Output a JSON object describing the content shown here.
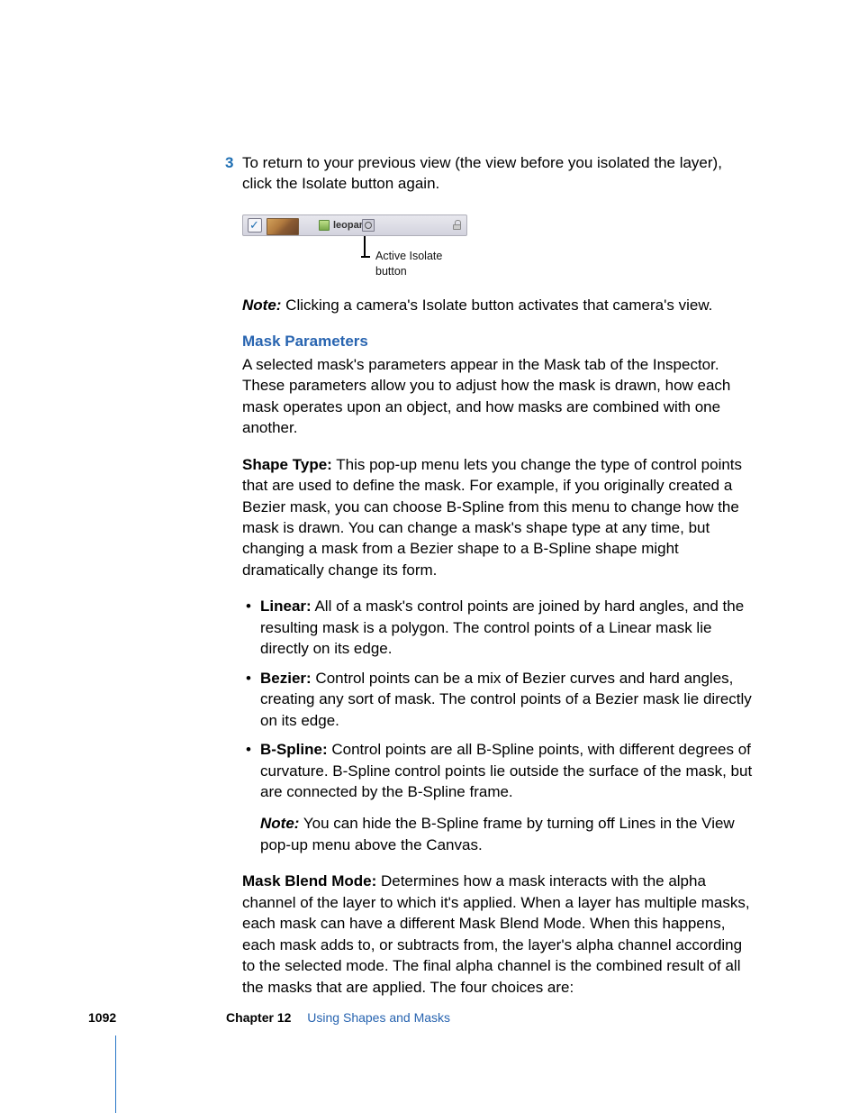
{
  "step": {
    "num": "3",
    "text": "To return to your previous view (the view before you isolated the layer), click the Isolate button again."
  },
  "figure": {
    "layer_name": "leopard",
    "caption": "Active Isolate button"
  },
  "note1": {
    "label": "Note:",
    "text": " Clicking a camera's Isolate button activates that camera's view."
  },
  "heading": "Mask Parameters",
  "intro": "A selected mask's parameters appear in the Mask tab of the Inspector. These parameters allow you to adjust how the mask is drawn, how each mask operates upon an object, and how masks are combined with one another.",
  "shapeType": {
    "term": "Shape Type:",
    "body": " This pop-up menu lets you change the type of control points that are used to define the mask. For example, if you originally created a Bezier mask, you can choose B-Spline from this menu to change how the mask is drawn. You can change a mask's shape type at any time, but changing a mask from a Bezier shape to a B-Spline shape might dramatically change its form."
  },
  "bullets": [
    {
      "term": "Linear:",
      "body": " All of a mask's control points are joined by hard angles, and the resulting mask is a polygon. The control points of a Linear mask lie directly on its edge."
    },
    {
      "term": "Bezier:",
      "body": " Control points can be a mix of Bezier curves and hard angles, creating any sort of mask. The control points of a Bezier mask lie directly on its edge."
    },
    {
      "term": "B-Spline:",
      "body": " Control points are all B-Spline points, with different degrees of curvature. B-Spline control points lie outside the surface of the mask, but are connected by the B-Spline frame."
    }
  ],
  "note2": {
    "label": "Note:",
    "text": " You can hide the B-Spline frame by turning off Lines in the View pop-up menu above the Canvas."
  },
  "blendMode": {
    "term": "Mask Blend Mode:",
    "body": " Determines how a mask interacts with the alpha channel of the layer to which it's applied. When a layer has multiple masks, each mask can have a different Mask Blend Mode. When this happens, each mask adds to, or subtracts from, the layer's alpha channel according to the selected mode. The final alpha channel is the combined result of all the masks that are applied. The four choices are:"
  },
  "footer": {
    "page": "1092",
    "chapter": "Chapter 12",
    "title": "Using Shapes and Masks"
  }
}
